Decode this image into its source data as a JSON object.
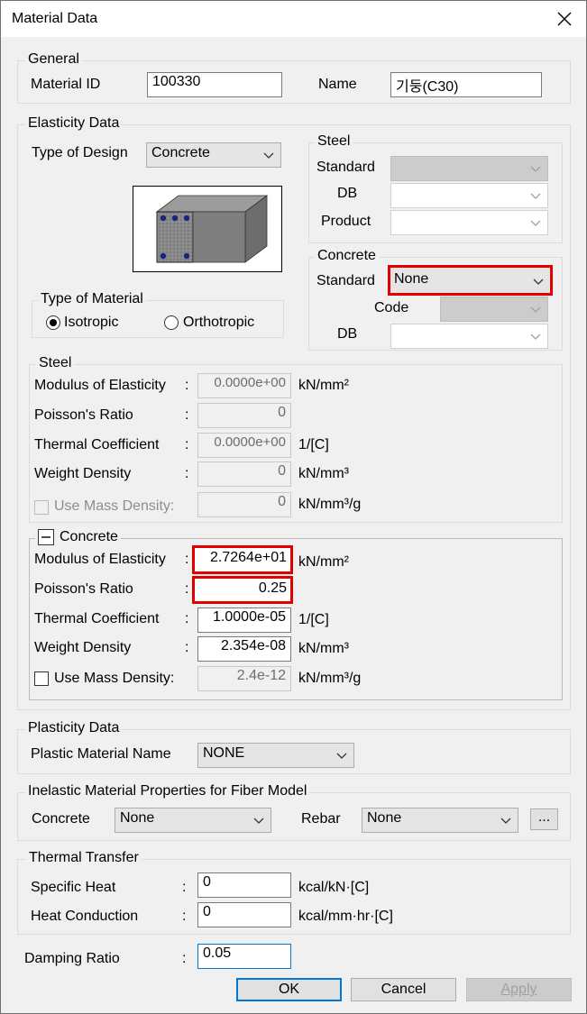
{
  "window": {
    "title": "Material Data"
  },
  "general": {
    "legend": "General",
    "material_id_label": "Material ID",
    "material_id_value": "100330",
    "name_label": "Name",
    "name_value": "기둥(C30)"
  },
  "elasticity": {
    "legend": "Elasticity Data",
    "type_of_design_label": "Type of Design",
    "type_of_design_value": "Concrete",
    "type_of_material": {
      "legend": "Type of Material",
      "isotropic": "Isotropic",
      "orthotropic": "Orthotropic",
      "selected": "Isotropic"
    },
    "steel_box": {
      "legend": "Steel",
      "standard_label": "Standard",
      "db_label": "DB",
      "product_label": "Product"
    },
    "concrete_box": {
      "legend": "Concrete",
      "standard_label": "Standard",
      "standard_value": "None",
      "code_label": "Code",
      "db_label": "DB"
    }
  },
  "steel_props": {
    "legend": "Steel",
    "rows": [
      {
        "label": "Modulus of Elasticity",
        "value": "0.0000e+00",
        "unit": "kN/mm²"
      },
      {
        "label": "Poisson's Ratio",
        "value": "0",
        "unit": ""
      },
      {
        "label": "Thermal Coefficient",
        "value": "0.0000e+00",
        "unit": "1/[C]"
      },
      {
        "label": "Weight Density",
        "value": "0",
        "unit": "kN/mm³"
      },
      {
        "label": "Use Mass Density:",
        "value": "0",
        "unit": "kN/mm³/g"
      }
    ]
  },
  "concrete_props": {
    "legend": "Concrete",
    "rows": [
      {
        "label": "Modulus of Elasticity",
        "value": "2.7264e+01",
        "unit": "kN/mm²"
      },
      {
        "label": "Poisson's Ratio",
        "value": "0.25",
        "unit": ""
      },
      {
        "label": "Thermal Coefficient",
        "value": "1.0000e-05",
        "unit": "1/[C]"
      },
      {
        "label": "Weight Density",
        "value": "2.354e-08",
        "unit": "kN/mm³"
      },
      {
        "label": "Use Mass Density:",
        "value": "2.4e-12",
        "unit": "kN/mm³/g"
      }
    ]
  },
  "plasticity": {
    "legend": "Plasticity Data",
    "label": "Plastic Material Name",
    "value": "NONE"
  },
  "inelastic": {
    "legend": "Inelastic Material Properties for Fiber Model",
    "concrete_label": "Concrete",
    "concrete_value": "None",
    "rebar_label": "Rebar",
    "rebar_value": "None",
    "more_button": "..."
  },
  "thermal": {
    "legend": "Thermal Transfer",
    "specific_heat_label": "Specific Heat",
    "specific_heat_value": "0",
    "specific_heat_unit": "kcal/kN·[C]",
    "heat_conduction_label": "Heat Conduction",
    "heat_conduction_value": "0",
    "heat_conduction_unit": "kcal/mm·hr·[C]"
  },
  "damping": {
    "label": "Damping Ratio",
    "value": "0.05"
  },
  "buttons": {
    "ok": "OK",
    "cancel": "Cancel",
    "apply": "Apply"
  },
  "colon": ":",
  "colors": {
    "highlight": "#e00000",
    "accent": "#0078d7"
  }
}
